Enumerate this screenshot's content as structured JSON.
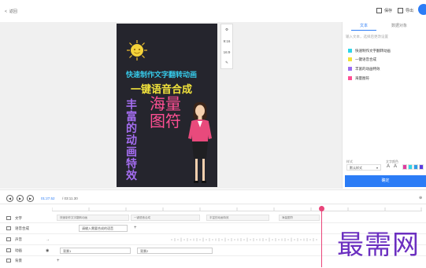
{
  "header": {
    "back_label": "返回",
    "save_label": "保存",
    "export_label": "导出"
  },
  "preview": {
    "line1": "快速制作文字翻转动画",
    "line2": "一键语音合成",
    "big_text": "海量图符",
    "vertical_text": "丰富的动画特效"
  },
  "tools": {
    "ratio_a": "9:16",
    "ratio_b": "16:9"
  },
  "panel": {
    "tabs": [
      "文本",
      "数据对象"
    ],
    "hint": "输入文本，选择后更改设置",
    "items": [
      {
        "label": "快速制作文字翻转动画",
        "color": "#2fd6e8"
      },
      {
        "label": "一键语音合成",
        "color": "#f1e23a"
      },
      {
        "label": "丰富的动画特效",
        "color": "#9b6cf0"
      },
      {
        "label": "海量图符",
        "color": "#ff4f93"
      }
    ],
    "style_label": "样式",
    "font_label": "文字颜色",
    "font_value": "默认样式",
    "swatches": [
      "#e03ca0",
      "#2fd6e8",
      "#2f9be8",
      "#5a3de0",
      "#3d6ae0"
    ],
    "confirm_label": "确定"
  },
  "playback": {
    "current": "01:27.52",
    "total": "03:11.30"
  },
  "timeline": {
    "tracks": [
      "文字",
      "语音合成",
      "声音",
      "动画",
      "背景"
    ],
    "text_clips": [
      "快速制作文字翻转动画",
      "一键语音合成",
      "丰富的动画特效",
      "海量图符"
    ],
    "voice_clip": "请输入需要合成的语音",
    "video_clips": [
      "背景1",
      "背景2"
    ]
  },
  "watermark": "最需网",
  "colors": {
    "accent": "#2b7cf6",
    "playhead": "#e9457a",
    "watermark": "#6b2fc0"
  }
}
